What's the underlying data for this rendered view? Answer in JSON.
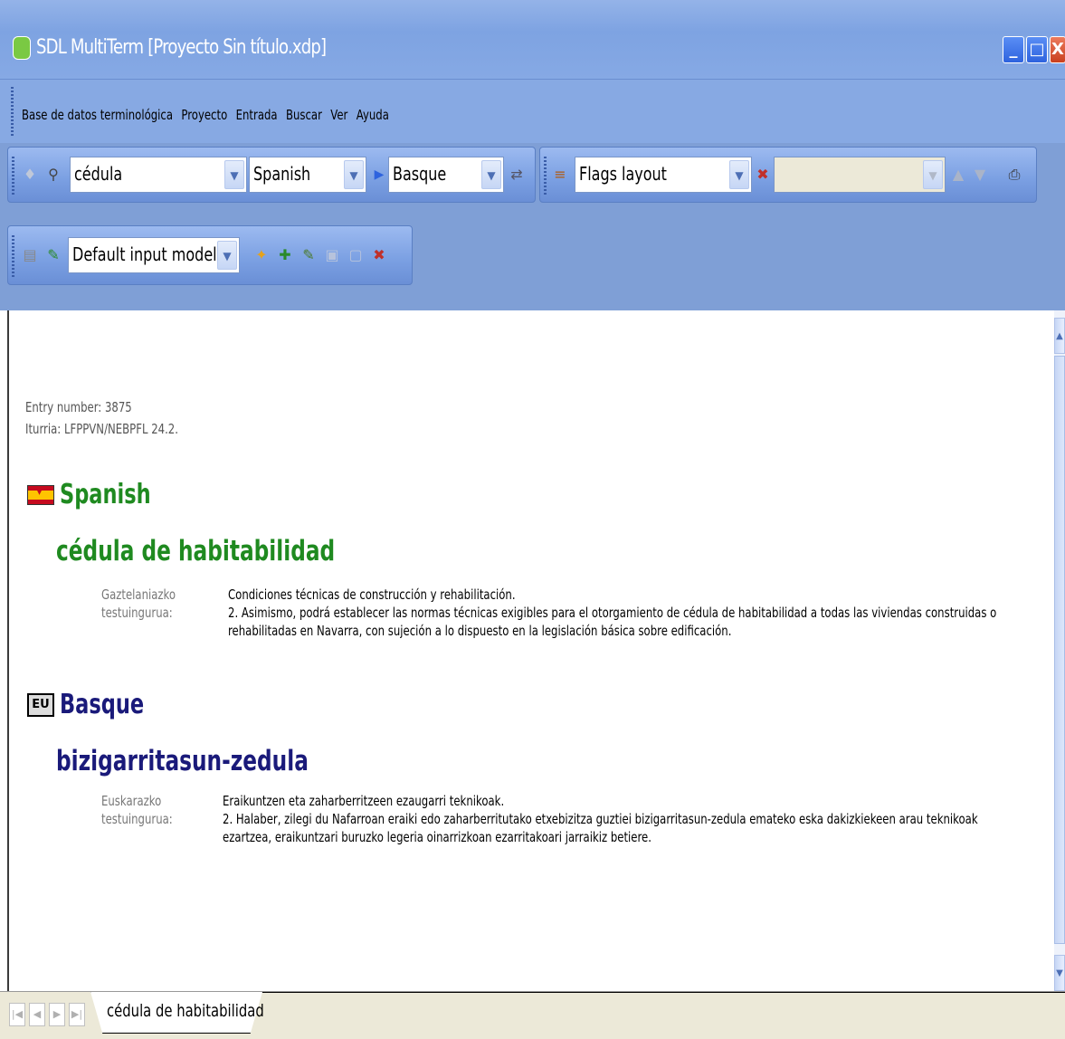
{
  "window": {
    "title": "SDL MultiTerm [Proyecto Sin título.xdp]"
  },
  "menu": {
    "items": [
      "Base de datos terminológica",
      "Proyecto",
      "Entrada",
      "Buscar",
      "Ver",
      "Ayuda"
    ]
  },
  "toolbar": {
    "search_value": "cédula",
    "source_language": "Spanish",
    "target_language": "Basque",
    "layout": "Flags layout",
    "input_model": "Default input model"
  },
  "entry": {
    "number_label": "Entry number: 3875",
    "source_label": "Iturria: LFPPVN/NEBPFL 24.2.",
    "languages": [
      {
        "name": "Spanish",
        "flag": "ES",
        "term": "cédula de habitabilidad",
        "context_label_1": "Gaztelaniazko",
        "context_label_2": "testuingurua:",
        "context_line_1": "Condiciones técnicas de construcción y rehabilitación.",
        "context_line_2": "2. Asimismo, podrá establecer las normas técnicas exigibles para el otorgamiento de cédula de habitabilidad a todas las viviendas construidas o",
        "context_line_3": "rehabilitadas en Navarra, con sujeción a lo dispuesto en la legislación básica sobre edificación."
      },
      {
        "name": "Basque",
        "flag": "EU",
        "term": "bizigarritasun-zedula",
        "context_label_1": "Euskarazko",
        "context_label_2": "testuingurua:",
        "context_line_1": "Eraikuntzen eta zaharberritzeen ezaugarri teknikoak.",
        "context_line_2": "2. Halaber, zilegi du Nafarroan eraiki edo zaharberritutako etxebizitza guztiei bizigarritasun-zedula emateko eska dakizkiekeen arau teknikoak",
        "context_line_3": "ezartzea, eraikuntzari buruzko legeria oinarrizkoan ezarritakoari jarraikiz betiere."
      }
    ]
  },
  "tabs": {
    "active": "cédula de habitabilidad"
  },
  "colors": {
    "spanish": "#1f8a20",
    "basque": "#1a1a7a",
    "titlebar": "#7ea3e2"
  }
}
